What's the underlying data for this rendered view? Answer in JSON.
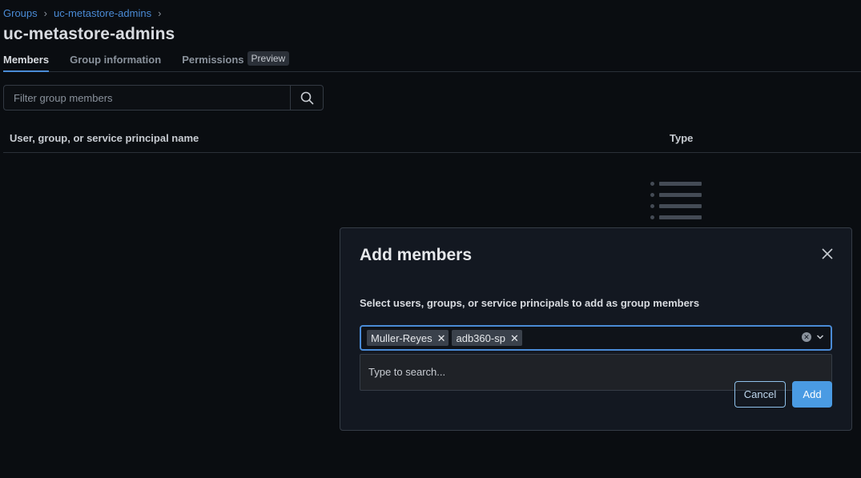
{
  "breadcrumb": {
    "items": [
      "Groups",
      "uc-metastore-admins"
    ],
    "separator": "›"
  },
  "page": {
    "title": "uc-metastore-admins"
  },
  "tabs": [
    {
      "label": "Members",
      "active": true
    },
    {
      "label": "Group information",
      "active": false
    },
    {
      "label": "Permissions",
      "active": false,
      "badge": "Preview"
    }
  ],
  "filter": {
    "placeholder": "Filter group members",
    "value": ""
  },
  "table": {
    "columns": [
      "User, group, or service principal name",
      "Type"
    ]
  },
  "modal": {
    "title": "Add members",
    "description": "Select users, groups, or service principals to add as group members",
    "selected": [
      "Muller-Reyes",
      "adb360-sp"
    ],
    "search_placeholder": "Type to search...",
    "cancel_label": "Cancel",
    "add_label": "Add"
  },
  "colors": {
    "accent": "#4a8bd6",
    "background": "#0a0d11",
    "modal_bg": "#131821",
    "primary_button": "#4a9be3"
  }
}
